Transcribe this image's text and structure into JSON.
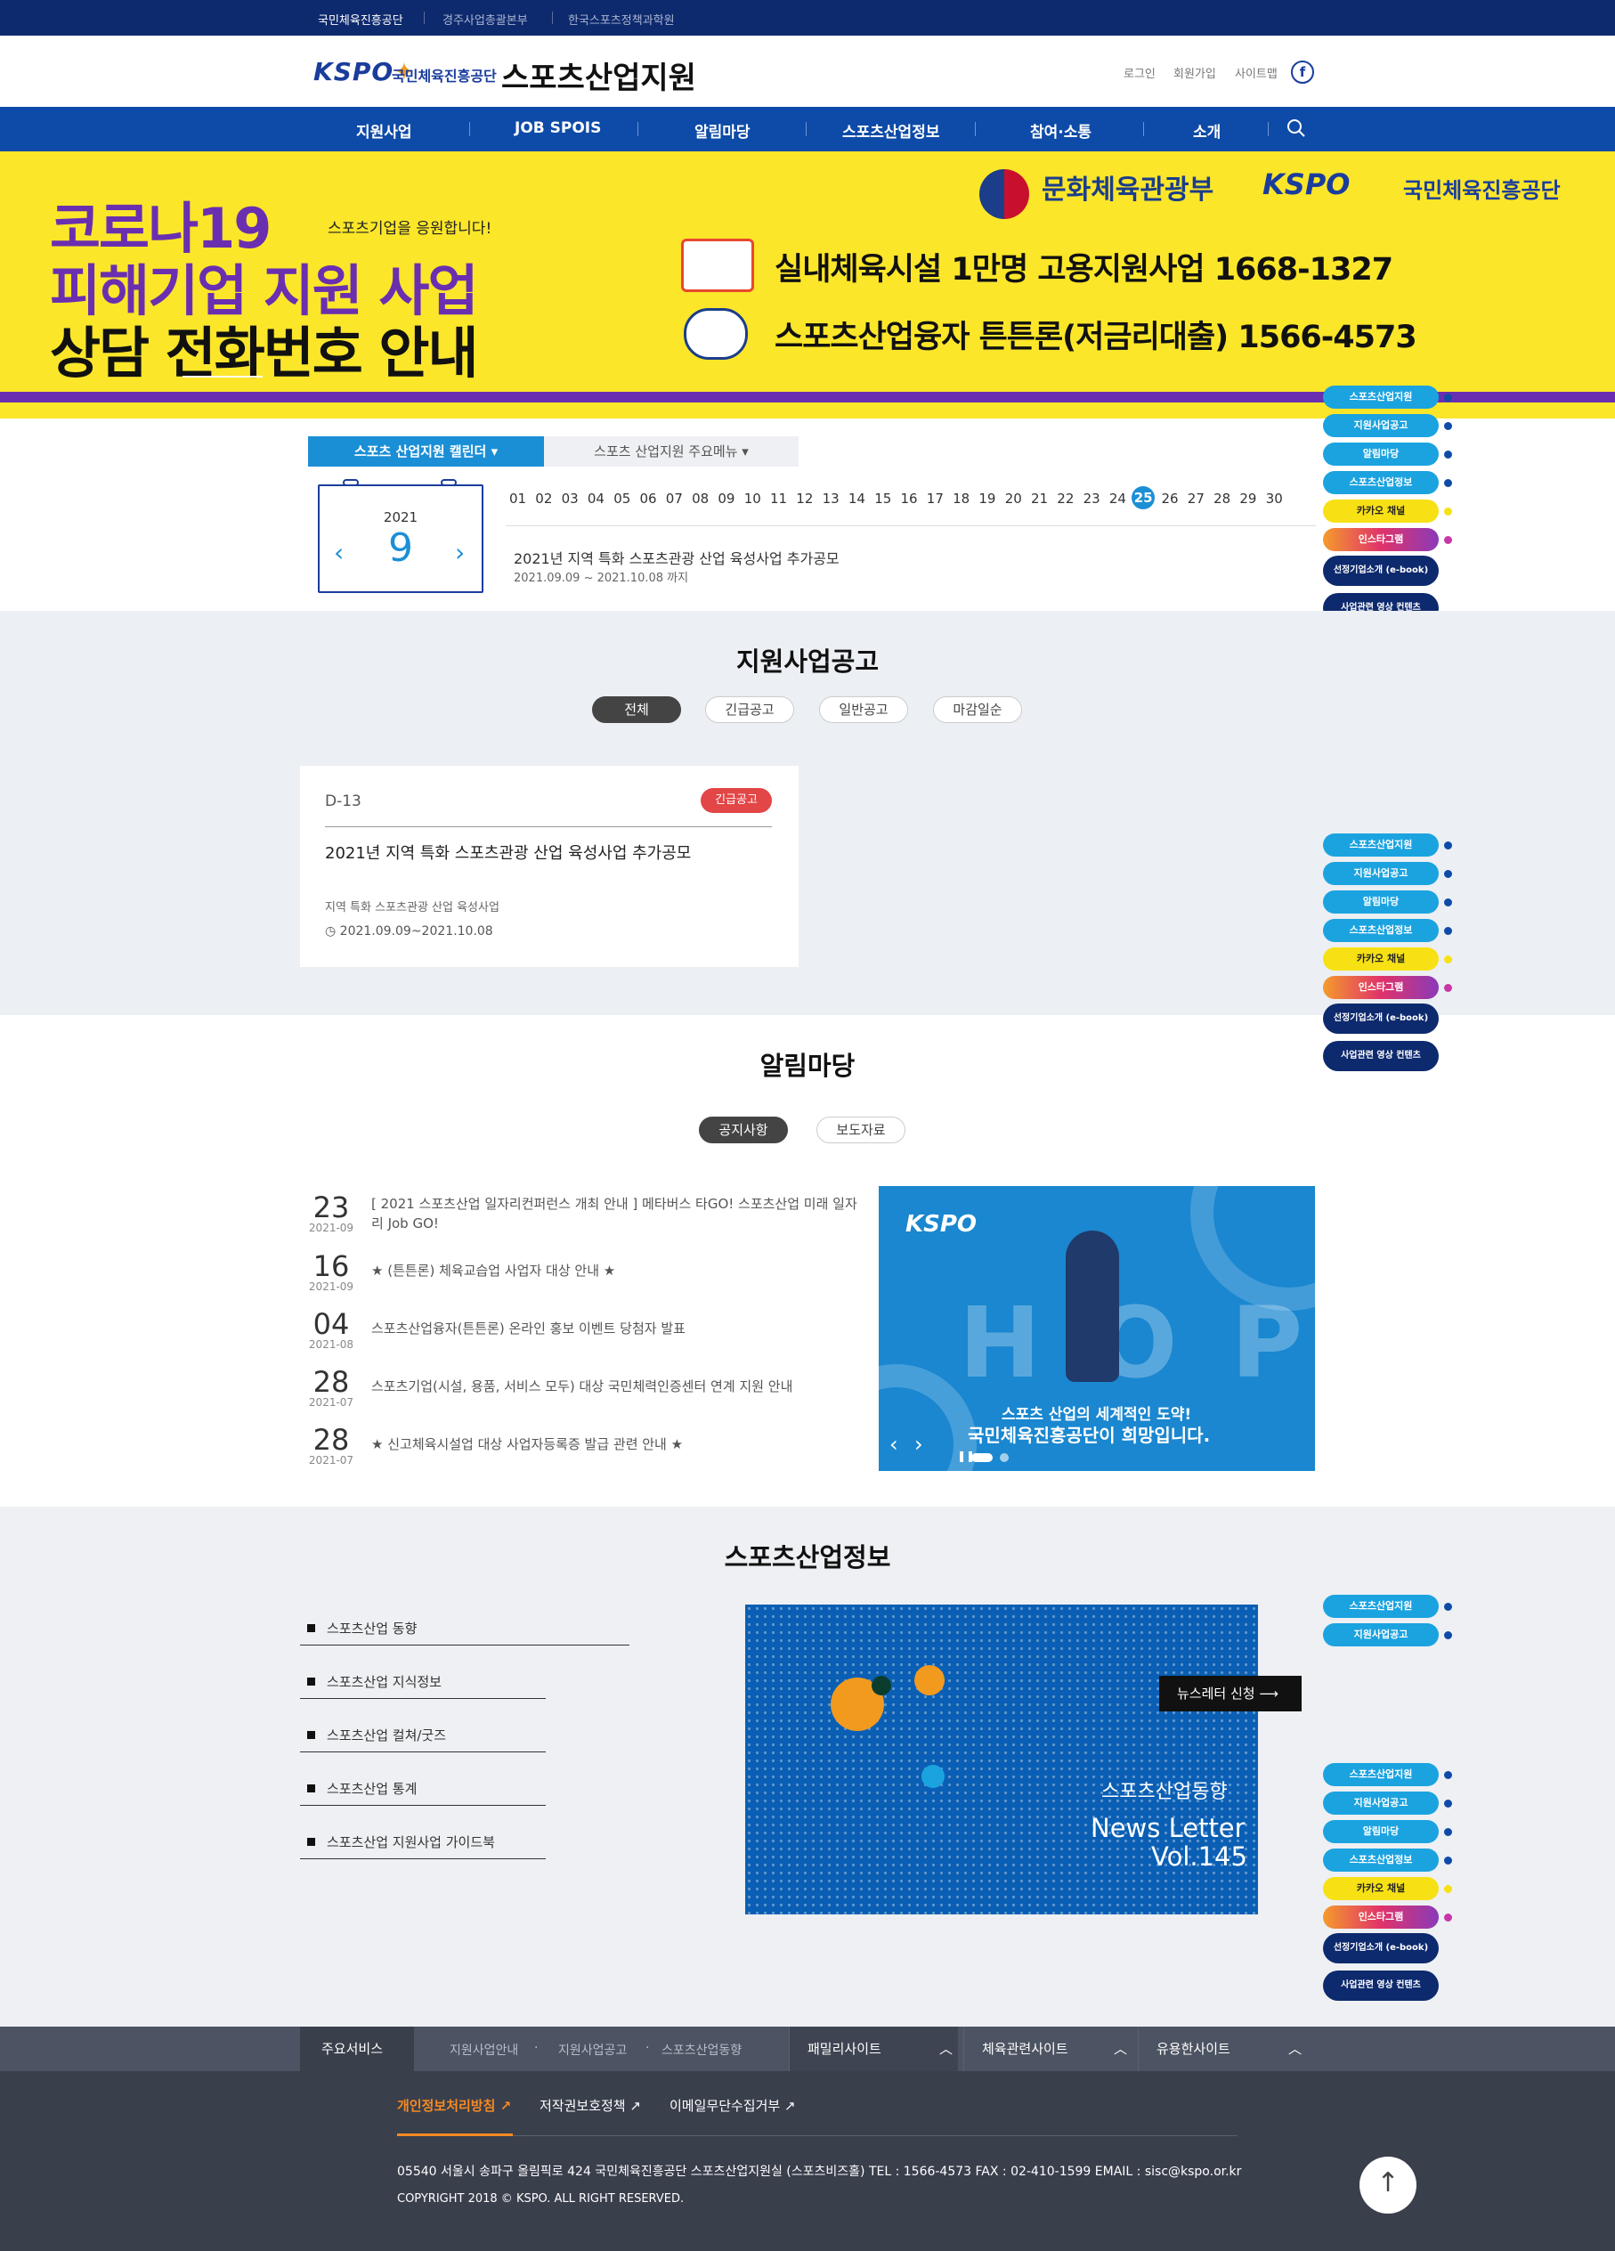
{
  "topbar": {
    "links": [
      "국민체육진흥공단",
      "경주사업총괄본부",
      "한국스포츠정책과학원"
    ]
  },
  "header": {
    "logo": "KSPO",
    "logo_sub": "국민체육진흥공단",
    "title": "스포츠산업지원",
    "links": [
      "로그인",
      "회원가입",
      "사이트맵"
    ],
    "fb": "f"
  },
  "gnb": {
    "items": [
      "지원사업",
      "JOB SPOIS",
      "알림마당",
      "스포츠산업정보",
      "참여·소통",
      "소개"
    ]
  },
  "banner": {
    "line1": "코로나19",
    "line2": "피해기업 지원 사업",
    "line3": "상담 전화번호 안내",
    "small": "스포츠기업을 응원합니다!",
    "row1": "실내체육시설 1만명 고용지원사업   1668-1327",
    "row2": "스포츠산업융자 튼튼론(저금리대출)   1566-4573",
    "gov": "문화체육관광부",
    "kspo": "KSPO",
    "kspo_sub": "국민체육진흥공단"
  },
  "quick": [
    "스포츠산업지원",
    "지원사업공고",
    "알림마당",
    "스포츠산업정보",
    "카카오 채널",
    "인스타그램",
    "선정기업소개 (e-book)",
    "사업관련 영상 컨텐츠"
  ],
  "calendar": {
    "tab_active": "스포츠 산업지원 캘린더",
    "tab_other": "스포츠 산업지원 주요메뉴",
    "year": "2021",
    "month": "9",
    "days": [
      "01",
      "02",
      "03",
      "04",
      "05",
      "06",
      "07",
      "08",
      "09",
      "10",
      "11",
      "12",
      "13",
      "14",
      "15",
      "16",
      "17",
      "18",
      "19",
      "20",
      "21",
      "22",
      "23",
      "24",
      "25",
      "26",
      "27",
      "28",
      "29",
      "30"
    ],
    "selected": "25",
    "event_title": "2021년 지역 특화 스포츠관광 산업 육성사업 추가공모",
    "event_date": "2021.09.09 ~ 2021.10.08 까지"
  },
  "support": {
    "title": "지원사업공고",
    "filters": [
      "전체",
      "긴급공고",
      "일반공고",
      "마감일순"
    ],
    "card": {
      "dday": "D-13",
      "badge": "긴급공고",
      "title": "2021년 지역 특화 스포츠관광 산업 육성사업 추가공모",
      "sub": "지역 특화 스포츠관광 산업 육성사업",
      "period": "2021.09.09~2021.10.08"
    }
  },
  "notice": {
    "title": "알림마당",
    "tabs": [
      "공지사항",
      "보도자료"
    ],
    "items": [
      {
        "day": "23",
        "ym": "2021-09",
        "text": "[ 2021 스포츠산업 일자리컨퍼런스 개최 안내 ] 메타버스 타GO! 스포츠산업 미래 일자리 Job GO!"
      },
      {
        "day": "16",
        "ym": "2021-09",
        "text": "★ (튼튼론) 체육교습업 사업자 대상 안내 ★"
      },
      {
        "day": "04",
        "ym": "2021-08",
        "text": "스포츠산업융자(튼튼론) 온라인 홍보 이벤트 당첨자 발표"
      },
      {
        "day": "28",
        "ym": "2021-07",
        "text": "스포츠기업(시설, 용품, 서비스 모두) 대상 국민체력인증센터 연계 지원 안내"
      },
      {
        "day": "28",
        "ym": "2021-07",
        "text": "★ 신고체육시설업 대상 사업자등록증 발급 관련 안내 ★"
      }
    ],
    "promo": {
      "logo": "KSPO",
      "hop": "HOP",
      "line1": "스포츠 산업의 세계적인 도약!",
      "line2": "국민체육진흥공단이 희망입니다."
    }
  },
  "info": {
    "title": "스포츠산업정보",
    "items": [
      "스포츠산업 동향",
      "스포츠산업 지식정보",
      "스포츠산업 컬쳐/굿즈",
      "스포츠산업 통계",
      "스포츠산업 지원사업 가이드북"
    ],
    "news_btn": "뉴스레터 신청",
    "map_title": "스포츠산업동향",
    "map_sub1": "News Letter",
    "map_sub2": "Vol.145"
  },
  "footer": {
    "main_service": "주요서비스",
    "services": [
      "지원사업안내",
      "지원사업공고",
      "스포츠산업동향"
    ],
    "boxes": [
      "패밀리사이트",
      "체육관련사이트",
      "유용한사이트"
    ],
    "links": [
      "개인정보처리방침",
      "저작권보호정책",
      "이메일무단수집거부"
    ],
    "address": "05540 서울시 송파구 올림픽로 424 국민체육진흥공단 스포츠산업지원실 (스포츠비즈홀)    TEL : 1566-4573    FAX : 02-410-1599    EMAIL : sisc@kspo.or.kr",
    "copyright": "COPYRIGHT 2018 © KSPO. ALL RIGHT RESERVED."
  },
  "colors": {
    "navy": "#0e2a6e",
    "blue": "#0e4ba8",
    "sky": "#1b8fd6",
    "yellow": "#fbe62a",
    "purple": "#6a2fb0",
    "urgent": "#e34646"
  }
}
